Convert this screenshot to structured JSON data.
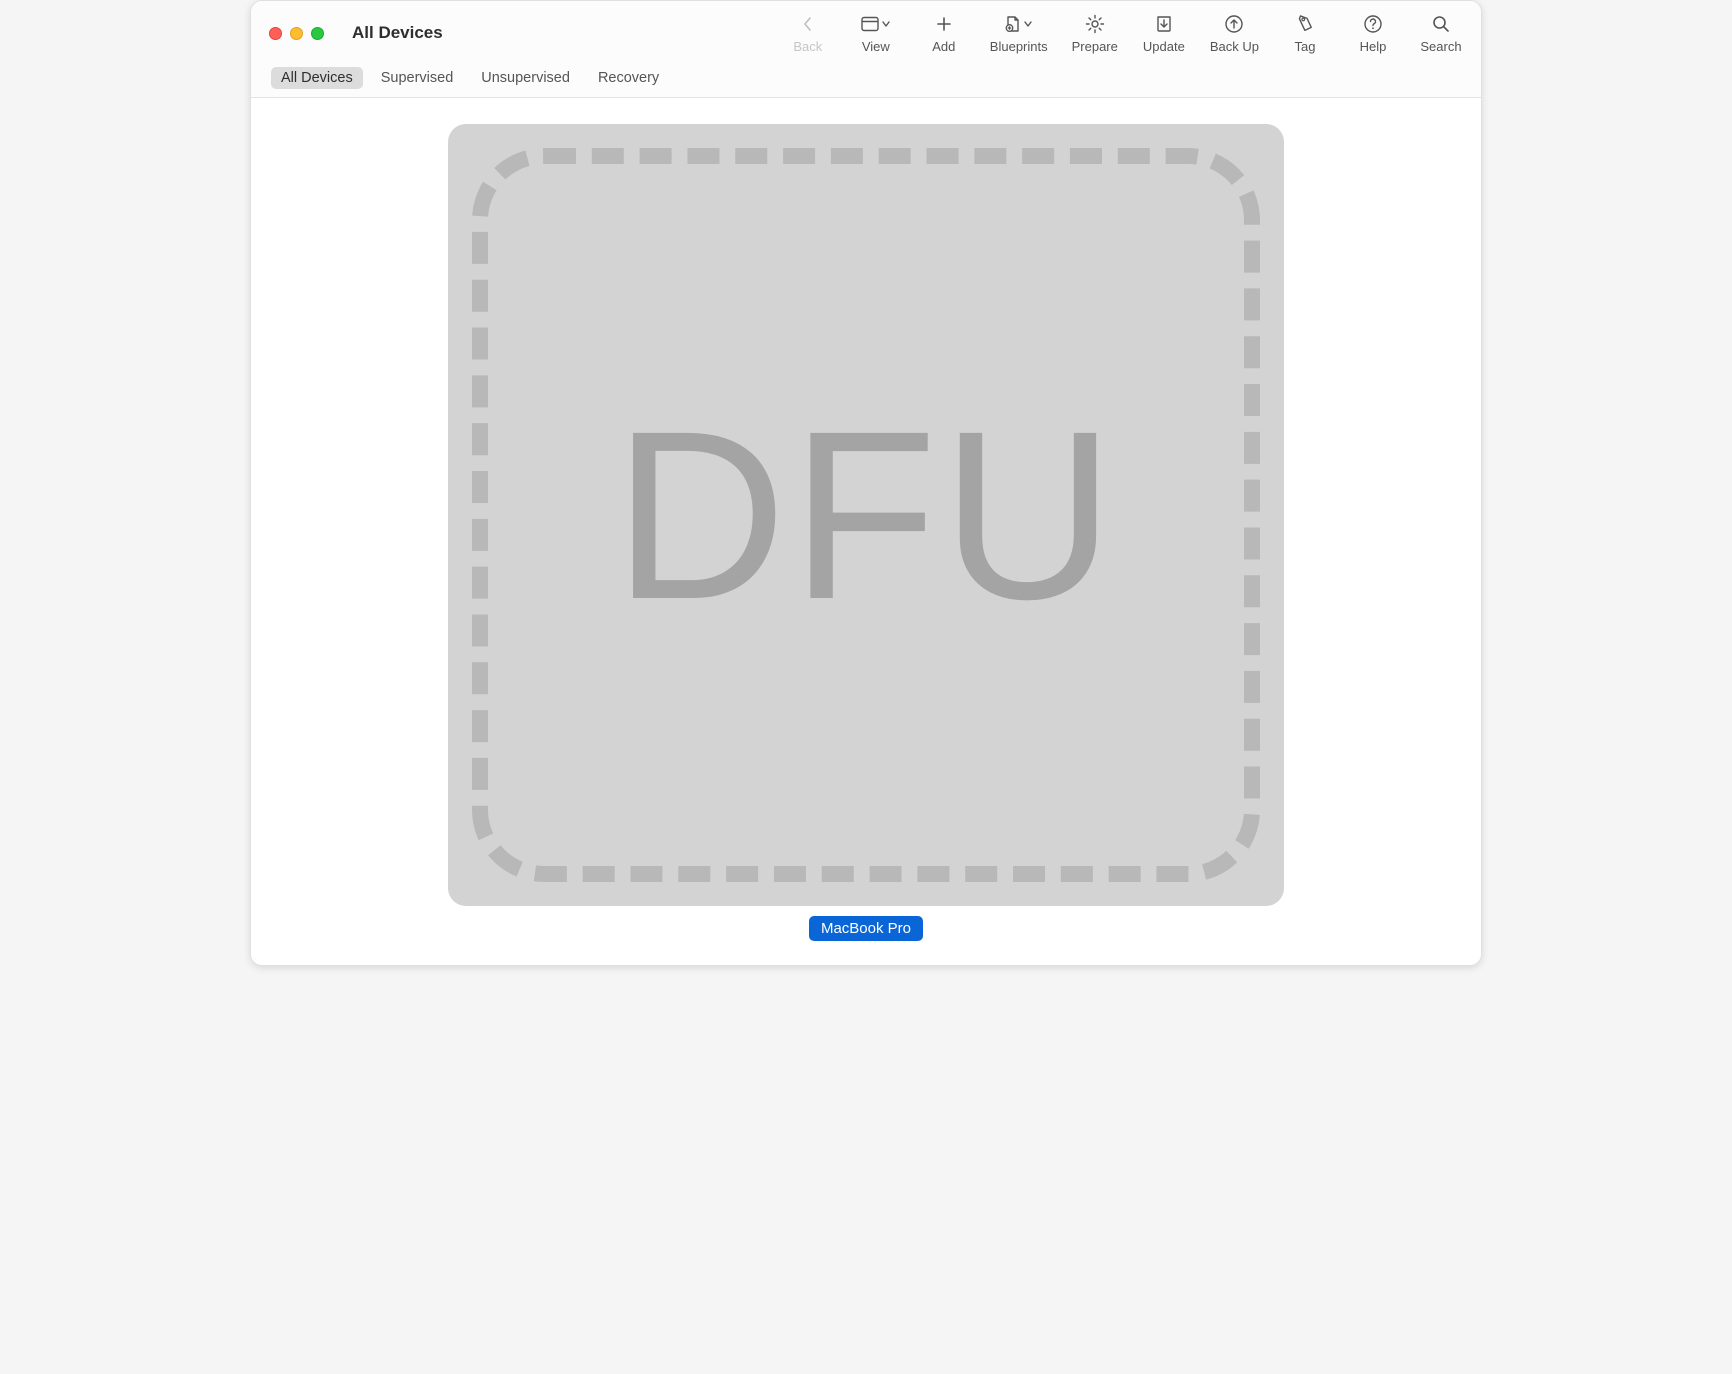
{
  "window": {
    "title": "All Devices"
  },
  "toolbar": {
    "items": [
      {
        "id": "back",
        "label": "Back",
        "disabled": true
      },
      {
        "id": "view",
        "label": "View"
      },
      {
        "id": "add",
        "label": "Add"
      },
      {
        "id": "blueprints",
        "label": "Blueprints"
      },
      {
        "id": "prepare",
        "label": "Prepare"
      },
      {
        "id": "update",
        "label": "Update"
      },
      {
        "id": "backup",
        "label": "Back Up"
      },
      {
        "id": "tag",
        "label": "Tag"
      },
      {
        "id": "help",
        "label": "Help"
      },
      {
        "id": "search",
        "label": "Search"
      }
    ]
  },
  "scope": {
    "items": [
      {
        "label": "All Devices",
        "selected": true
      },
      {
        "label": "Supervised"
      },
      {
        "label": "Unsupervised"
      },
      {
        "label": "Recovery"
      }
    ]
  },
  "device": {
    "badge_text": "DFU",
    "label": "MacBook Pro"
  }
}
